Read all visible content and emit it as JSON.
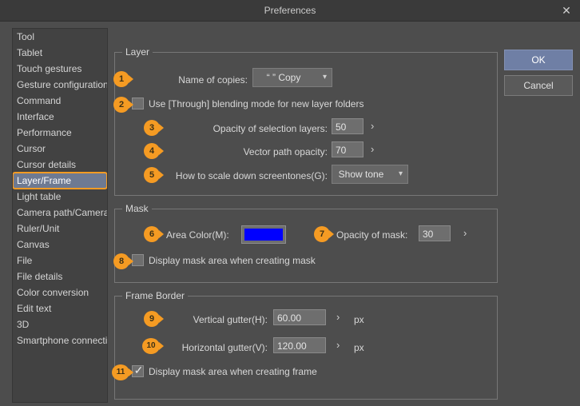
{
  "window": {
    "title": "Preferences",
    "close_icon": "close-icon"
  },
  "buttons": {
    "ok": "OK",
    "cancel": "Cancel"
  },
  "sidebar": {
    "items": [
      {
        "label": "Tool",
        "selected": false
      },
      {
        "label": "Tablet",
        "selected": false
      },
      {
        "label": "Touch gestures",
        "selected": false
      },
      {
        "label": "Gesture configuration",
        "selected": false
      },
      {
        "label": "Command",
        "selected": false
      },
      {
        "label": "Interface",
        "selected": false
      },
      {
        "label": "Performance",
        "selected": false
      },
      {
        "label": "Cursor",
        "selected": false
      },
      {
        "label": "Cursor details",
        "selected": false
      },
      {
        "label": "Layer/Frame",
        "selected": true
      },
      {
        "label": "Light table",
        "selected": false
      },
      {
        "label": "Camera path/Camera",
        "selected": false
      },
      {
        "label": "Ruler/Unit",
        "selected": false
      },
      {
        "label": "Canvas",
        "selected": false
      },
      {
        "label": "File",
        "selected": false
      },
      {
        "label": "File details",
        "selected": false
      },
      {
        "label": "Color conversion",
        "selected": false
      },
      {
        "label": "Edit text",
        "selected": false
      },
      {
        "label": "3D",
        "selected": false
      },
      {
        "label": "Smartphone connection",
        "selected": false
      }
    ]
  },
  "groups": {
    "layer": {
      "title": "Layer",
      "name_of_copies": {
        "badge": "1",
        "label": "Name of copies:",
        "value": "“  ” Copy",
        "caret": "chevron-down-icon"
      },
      "through_blending": {
        "badge": "2",
        "label": "Use [Through] blending mode for new layer folders",
        "checked": false
      },
      "opacity_selection_layers": {
        "badge": "3",
        "label": "Opacity of selection layers:",
        "value": "50",
        "spinner": "›"
      },
      "vector_path_opacity": {
        "badge": "4",
        "label": "Vector path opacity:",
        "value": "70",
        "spinner": "›"
      },
      "scale_down_screentones": {
        "badge": "5",
        "label": "How to scale down screentones(G):",
        "value": "Show tone",
        "caret": "chevron-down-icon"
      }
    },
    "mask": {
      "title": "Mask",
      "area_color": {
        "badge": "6",
        "label": "Area Color(M):",
        "color": "#0000ff"
      },
      "opacity_of_mask": {
        "badge": "7",
        "label": "Opacity of mask:",
        "value": "30",
        "spinner": "›"
      },
      "display_mask_area": {
        "badge": "8",
        "label": "Display mask area when creating mask",
        "checked": false
      }
    },
    "frame_border": {
      "title": "Frame Border",
      "vertical_gutter": {
        "badge": "9",
        "label": "Vertical gutter(H):",
        "value": "60.00",
        "spinner": "›",
        "unit": "px"
      },
      "horizontal_gutter": {
        "badge": "10",
        "label": "Horizontal gutter(V):",
        "value": "120.00",
        "spinner": "›",
        "unit": "px"
      },
      "display_mask_area_frame": {
        "badge": "11",
        "label": "Display mask area when creating frame",
        "checked": true,
        "tick": "✓"
      }
    }
  },
  "colors": {
    "accent_badge": "#f59b23",
    "selection": "#6e7a92",
    "ok_button": "#6f7fa5",
    "area_color": "#0000ff"
  }
}
